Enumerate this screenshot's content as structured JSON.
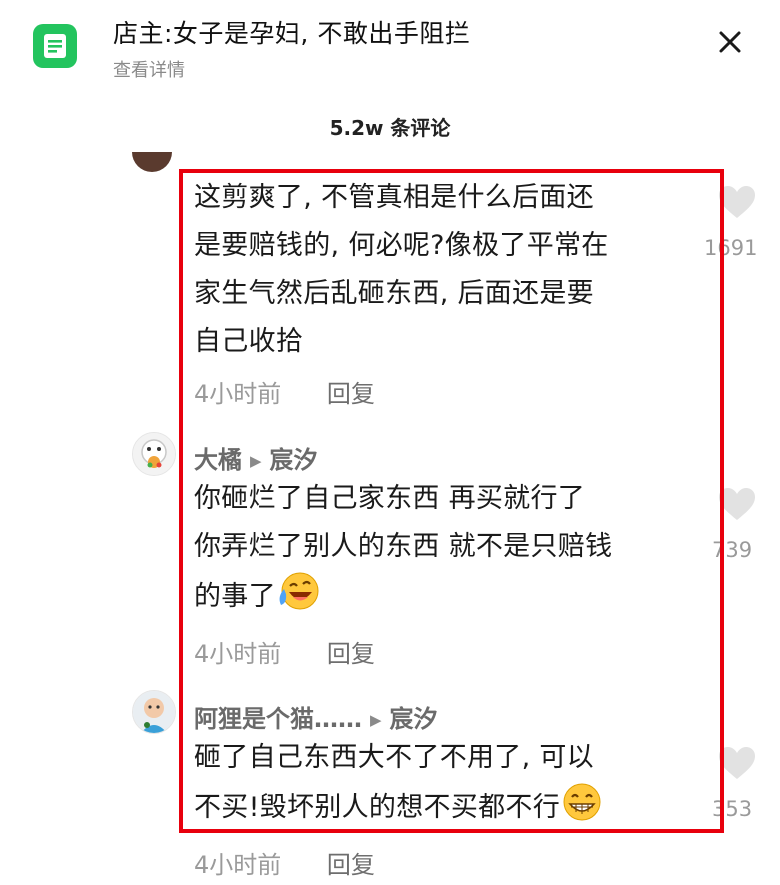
{
  "header": {
    "title": "店主:女子是孕妇, 不敢出手阻拦",
    "subtitle": "查看详情"
  },
  "comments_header": {
    "count": "5.2w 条评论"
  },
  "comments": [
    {
      "text_lines": [
        "这剪爽了, 不管真相是什么后面还",
        "是要赔钱的, 何必呢?像极了平常在",
        "家生气然后乱砸东西, 后面还是要",
        "自己收拾"
      ],
      "time": "4小时前",
      "reply_label": "回复",
      "likes": "1691"
    },
    {
      "user": "大橘",
      "reply_to": "宸汐",
      "text_lines": [
        "你砸烂了自己家东西  再买就行了",
        "你弄烂了别人的东西  就不是只赔钱",
        "的事了"
      ],
      "time": "4小时前",
      "reply_label": "回复",
      "likes": "739"
    },
    {
      "user": "阿狸是个猫……",
      "reply_to": "宸汐",
      "text_lines": [
        "砸了自己东西大不了不用了, 可以",
        "不买!毁坏别人的想不买都不行"
      ],
      "time": "4小时前",
      "reply_label": "回复",
      "likes": "353"
    }
  ],
  "colors": {
    "accent_green": "#23c45e",
    "highlight_red": "#e8000d"
  },
  "icons": [
    "document-icon",
    "close-icon",
    "heart-icon",
    "laugh-cry-emoji-icon",
    "grin-emoji-icon"
  ]
}
